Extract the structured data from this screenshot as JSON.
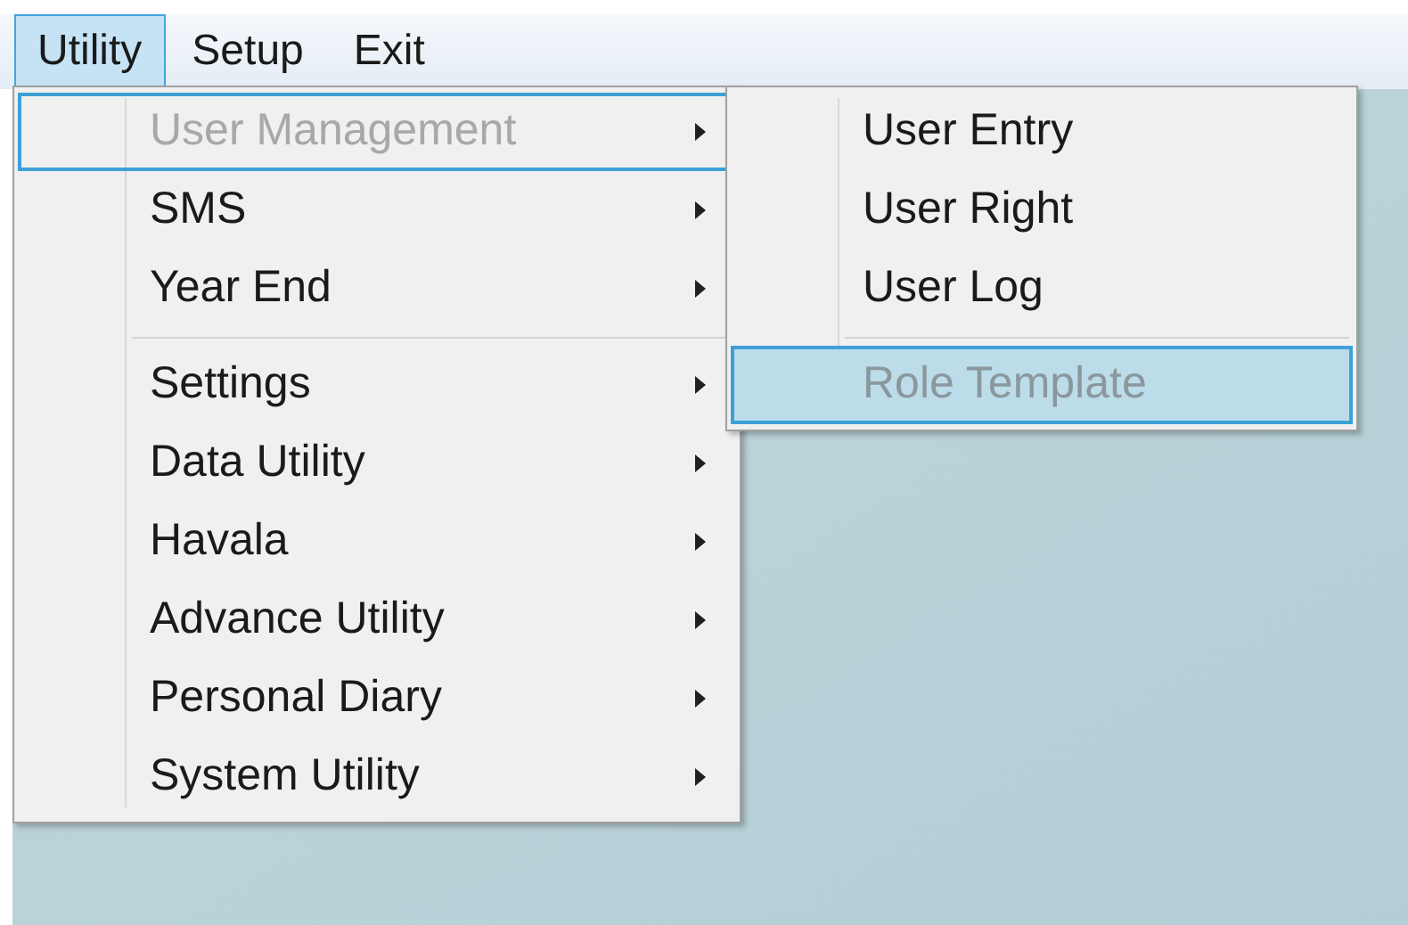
{
  "menu_bar": [
    {
      "label": "Utility",
      "selected": true
    },
    {
      "label": "Setup",
      "selected": false
    },
    {
      "label": "Exit",
      "selected": false
    }
  ],
  "utility_menu": [
    {
      "kind": "item",
      "label": "User Management",
      "disabled": true,
      "selected": true,
      "submenu": true
    },
    {
      "kind": "item",
      "label": "SMS",
      "disabled": false,
      "selected": false,
      "submenu": true
    },
    {
      "kind": "item",
      "label": "Year End",
      "disabled": false,
      "selected": false,
      "submenu": true
    },
    {
      "kind": "separator"
    },
    {
      "kind": "item",
      "label": "Settings",
      "disabled": false,
      "selected": false,
      "submenu": true
    },
    {
      "kind": "item",
      "label": "Data Utility",
      "disabled": false,
      "selected": false,
      "submenu": true
    },
    {
      "kind": "item",
      "label": "Havala",
      "disabled": false,
      "selected": false,
      "submenu": true
    },
    {
      "kind": "item",
      "label": "Advance Utility",
      "disabled": false,
      "selected": false,
      "submenu": true
    },
    {
      "kind": "item",
      "label": "Personal Diary",
      "disabled": false,
      "selected": false,
      "submenu": true
    },
    {
      "kind": "item",
      "label": "System Utility",
      "disabled": false,
      "selected": false,
      "submenu": true
    }
  ],
  "user_management_submenu": [
    {
      "kind": "item",
      "label": "User Entry",
      "disabled": false,
      "selected": false,
      "submenu": false
    },
    {
      "kind": "item",
      "label": "User Right",
      "disabled": false,
      "selected": false,
      "submenu": false
    },
    {
      "kind": "item",
      "label": "User Log",
      "disabled": false,
      "selected": false,
      "submenu": false
    },
    {
      "kind": "separator"
    },
    {
      "kind": "item",
      "label": "Role Template",
      "disabled": true,
      "selected": true,
      "submenu": false
    }
  ]
}
